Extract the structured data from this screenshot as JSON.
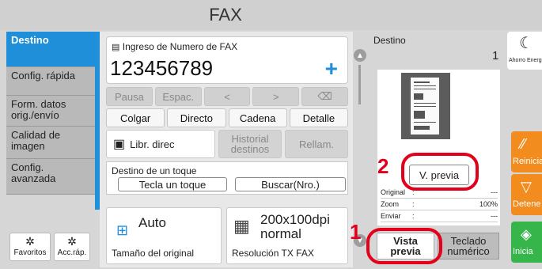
{
  "title": "FAX",
  "tabs": [
    {
      "label": "Destino"
    },
    {
      "label": "Config. rápida"
    },
    {
      "label": "Form. datos orig./envío"
    },
    {
      "label": "Calidad de imagen"
    },
    {
      "label": "Config. avanzada"
    }
  ],
  "entry": {
    "label": "Ingreso de Numero de FAX",
    "value": "123456789",
    "add": "+"
  },
  "keys": [
    "Pausa",
    "Espac.",
    "<",
    ">",
    "⌫"
  ],
  "actions": [
    "Colgar",
    "Directo",
    "Cadena",
    "Detalle"
  ],
  "libr_direc": "Libr. direc",
  "historial": "Historial destinos",
  "rellam": "Rellam.",
  "onetouch": {
    "label": "Destino de un toque",
    "tecla": "Tecla un toque",
    "buscar": "Buscar(Nro.)"
  },
  "settings": {
    "size_value": "Auto",
    "size_caption": "Tamaño del original",
    "res_value": "200x100dpi normal",
    "res_caption": "Resolución TX FAX"
  },
  "favorites": {
    "fav": "Favoritos",
    "acc": "Acc.ráp."
  },
  "preview": {
    "destino": "Destino",
    "count": "1",
    "vprev": "V. previa",
    "rows": [
      {
        "k": "Original",
        "c": ":",
        "v": "---"
      },
      {
        "k": "Zoom",
        "c": ":",
        "v": "100%"
      },
      {
        "k": "Enviar",
        "c": ":",
        "v": "---"
      }
    ],
    "vista": "Vista previa",
    "teclado": "Teclado numérico"
  },
  "callouts": {
    "one_top": "1",
    "two": "2",
    "one_bottom": "1"
  },
  "right": {
    "ahorro": "Ahorro Energ",
    "reiniciar": "Reinicia",
    "detener": "Detene",
    "iniciar": "Inicia"
  },
  "colors": {
    "accent": "#1e8fd8",
    "callout": "#e3001b",
    "orange": "#f28c1e",
    "green": "#36b54a"
  }
}
